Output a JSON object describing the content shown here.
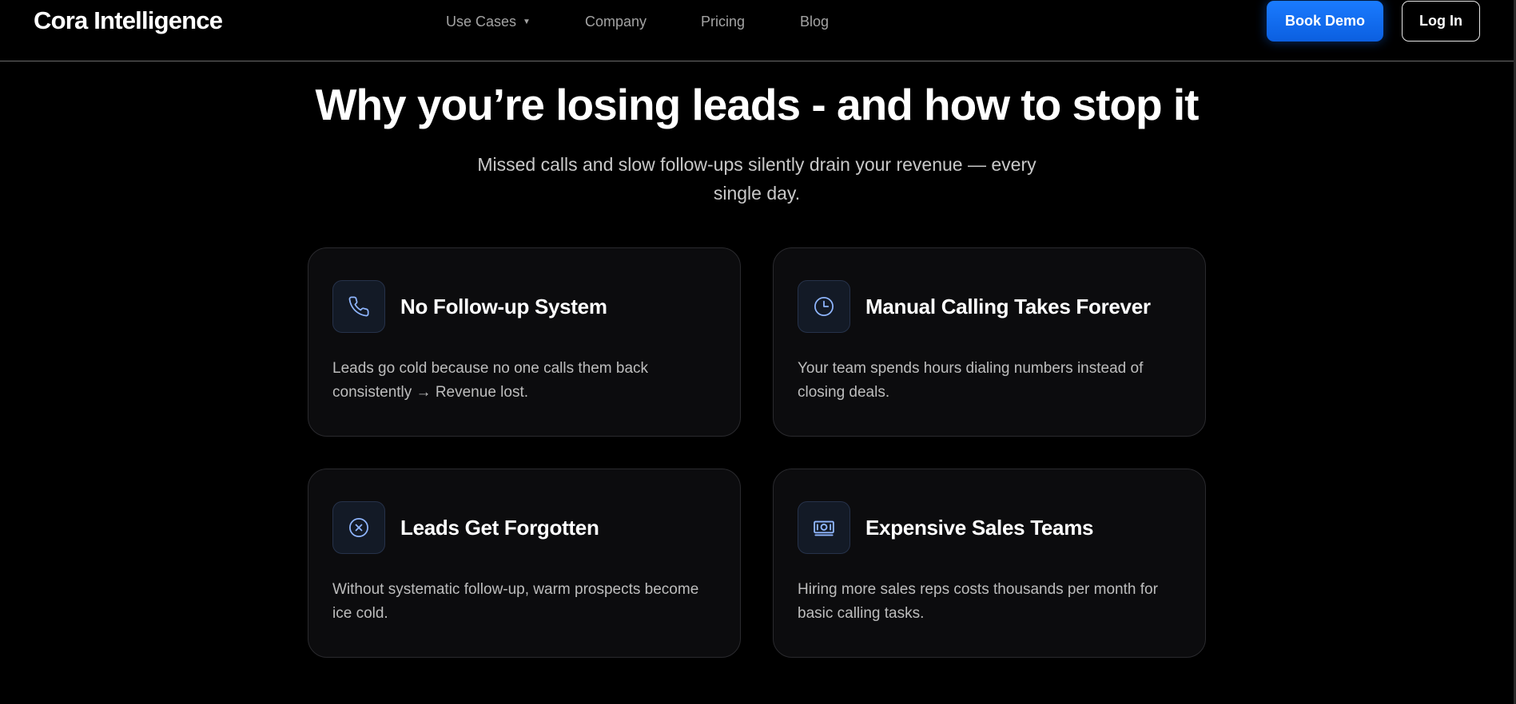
{
  "nav": {
    "logo": "Cora Intelligence",
    "links": [
      "Use Cases",
      "Company",
      "Pricing",
      "Blog"
    ],
    "book_demo": "Book Demo",
    "login": "Log In"
  },
  "hero": {
    "title": "Why you’re losing leads - and how to stop it",
    "subtitle": "Missed calls and slow follow-ups silently drain your revenue — every single day."
  },
  "cards": [
    {
      "icon": "phone-icon",
      "title": "No Follow-up System",
      "description": "Leads go cold because no one calls them back consistently → Revenue lost."
    },
    {
      "icon": "clock-icon",
      "title": "Manual Calling Takes Forever",
      "description": "Your team spends hours dialing numbers instead of closing deals."
    },
    {
      "icon": "x-circle-icon",
      "title": "Leads Get Forgotten",
      "description": "Without systematic follow-up, warm prospects become ice cold."
    },
    {
      "icon": "banknote-icon",
      "title": "Expensive Sales Teams",
      "description": "Hiring more sales reps costs thousands per month for basic calling tasks."
    }
  ],
  "colors": {
    "accent": "#0b6cff",
    "icon_stroke": "#8fb6ff",
    "background": "#000000",
    "card_background": "#0c0c0e"
  }
}
